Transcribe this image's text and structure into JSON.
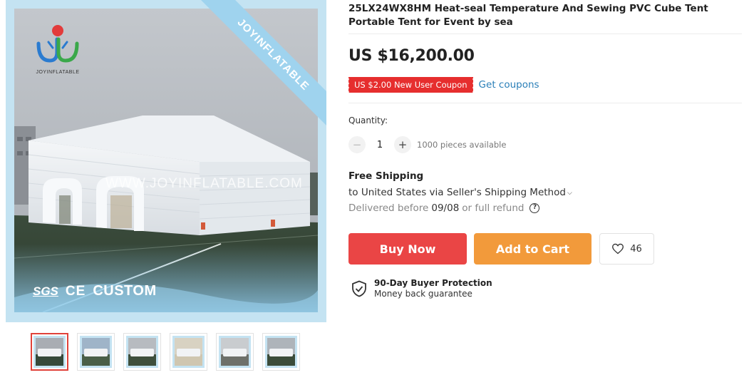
{
  "product": {
    "title": "25LX24WX8HM Heat-seal Temperature And Sewing PVC Cube Tent Portable Tent for Event by sea",
    "price": "US $16,200.00",
    "coupon_badge": "US $2.00 New User Coupon",
    "coupon_link": "Get coupons"
  },
  "gallery": {
    "corner_banner": "JOYINFLATABLE",
    "brand_name": "JOYINFLATABLE",
    "watermark": "WWW.JOYINFLATABLE.COM",
    "certifications": {
      "sgs": "SGS",
      "ce": "CE",
      "custom": "CUSTOM"
    },
    "thumbnails": [
      {
        "active": true,
        "sky": "#a9adb3",
        "grass": "#36493a"
      },
      {
        "active": false,
        "sky": "#9fb4c8",
        "grass": "#4a5f48"
      },
      {
        "active": false,
        "sky": "#b7bbc0",
        "grass": "#3e4f3c"
      },
      {
        "active": false,
        "sky": "#d8d2c2",
        "grass": "#cfc6b0"
      },
      {
        "active": false,
        "sky": "#c9cccf",
        "grass": "#6e706a"
      },
      {
        "active": false,
        "sky": "#aeb4ba",
        "grass": "#3b4c3a"
      }
    ]
  },
  "quantity": {
    "label": "Quantity:",
    "value": "1",
    "available": "1000 pieces available"
  },
  "shipping": {
    "title": "Free Shipping",
    "destination": "to United States via Seller's Shipping Method",
    "delivery_prefix": "Delivered before",
    "delivery_date": "09/08",
    "delivery_suffix": "or full refund"
  },
  "actions": {
    "buy_now": "Buy Now",
    "add_to_cart": "Add to Cart",
    "wishlist_count": "46"
  },
  "protection": {
    "title": "90-Day Buyer Protection",
    "subtitle": "Money back guarantee"
  },
  "colors": {
    "buy_now": "#ea4545",
    "add_to_cart": "#f29a3b",
    "coupon": "#e62e2e",
    "link": "#2a7fb8",
    "frame": "#c4e3f2"
  }
}
